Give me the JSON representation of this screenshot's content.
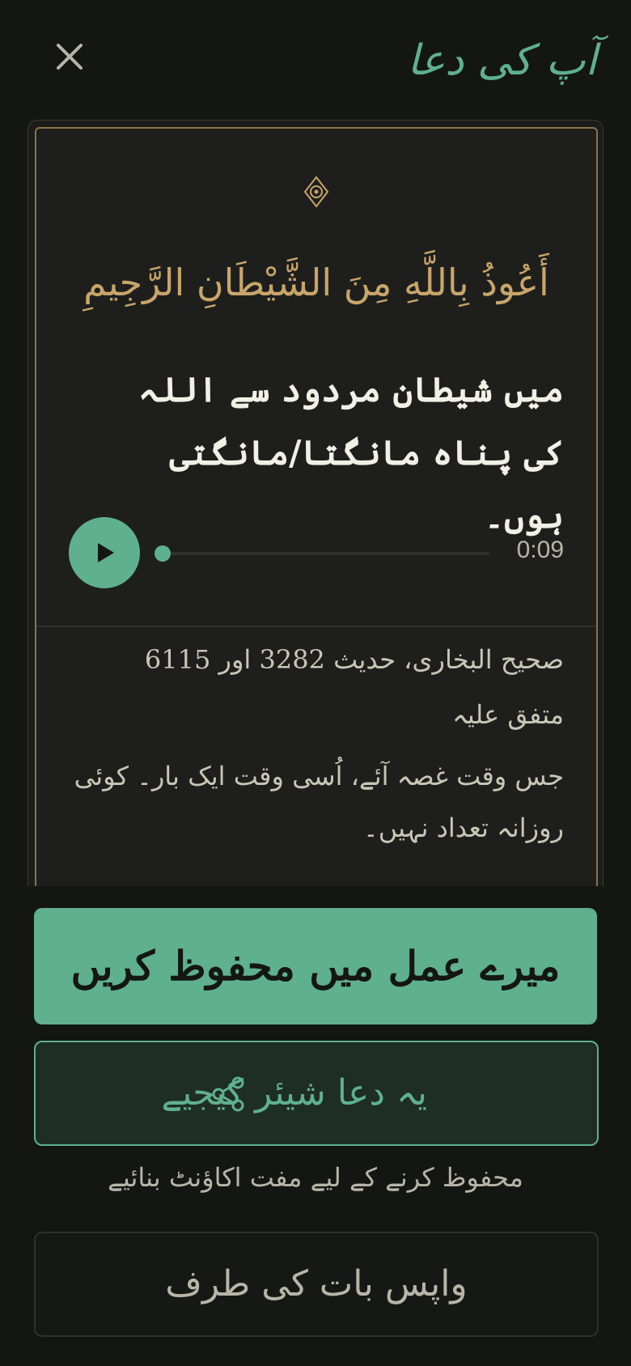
{
  "header": {
    "title": "آپ کی دعا",
    "close_icon": "close-icon"
  },
  "colors": {
    "background": "#141614",
    "accent": "#5fb08e",
    "gold": "#c9a56a",
    "text": "#f1efe6"
  },
  "dua": {
    "ornament_icon": "ornament-icon",
    "arabic": "أَعُوذُ بِاللَّهِ مِنَ الشَّيْطَانِ الرَّجِيمِ",
    "translation": "میں شیطان مردود سے اللہ کی پناہ مانگتا/مانگتی ہوں۔"
  },
  "audio": {
    "play_icon": "play-icon",
    "progress": 0.02,
    "time": "0:09"
  },
  "reference": {
    "source": "صحیح البخاری، حدیث 3282 اور 6115",
    "grade": "متفق علیہ",
    "note": "جس وقت غصہ آئے، اُسی وقت ایک بار۔ کوئی روزانہ تعداد نہیں۔"
  },
  "actions": {
    "save_label": "میرے عمل میں محفوظ کریں",
    "share_label": "یہ دعا شیئر کیجیے",
    "share_icon": "share-icon",
    "hint": "محفوظ کرنے کے لیے مفت اکاؤنٹ بنائیے",
    "back_label": "واپس بات کی طرف"
  }
}
